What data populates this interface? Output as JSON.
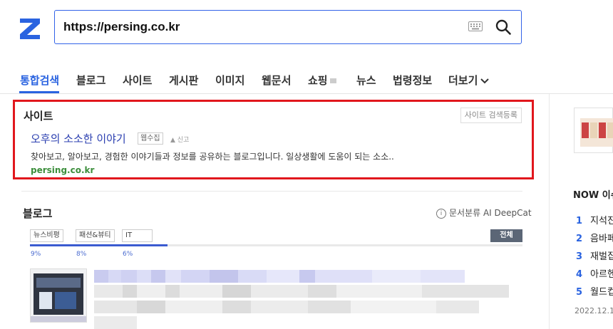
{
  "search": {
    "query": "https://persing.co.kr"
  },
  "tabs": [
    {
      "label": "통합검색",
      "active": true
    },
    {
      "label": "블로그"
    },
    {
      "label": "사이트"
    },
    {
      "label": "게시판"
    },
    {
      "label": "이미지"
    },
    {
      "label": "웹문서"
    },
    {
      "label": "쇼핑"
    },
    {
      "label": "뉴스"
    },
    {
      "label": "법령정보"
    },
    {
      "label": "더보기"
    }
  ],
  "site_section": {
    "title": "사이트",
    "register_label": "사이트 검색등록",
    "result": {
      "title": "오후의 소소한 이야기",
      "badge": "웹수집",
      "report": "신고",
      "description": "찾아보고, 알아보고, 경험한 이야기들과 정보를 공유하는 블로그입니다. 일상생활에 도움이 되는 소소..",
      "url": "persing.co.kr"
    }
  },
  "blog_section": {
    "title": "블로그",
    "deepcat_label": "문서분류 AI DeepCat",
    "categories": [
      {
        "label": "뉴스비평",
        "percent": "9%"
      },
      {
        "label": "패션&뷰티",
        "percent": "8%"
      },
      {
        "label": "IT",
        "percent": "6%"
      }
    ],
    "all_label": "전체",
    "progress": 0.28
  },
  "right_panel": {
    "now_title": "NOW 이슈",
    "ranks": [
      {
        "num": "1",
        "text": "지석진"
      },
      {
        "num": "2",
        "text": "음바페"
      },
      {
        "num": "3",
        "text": "재벌집"
      },
      {
        "num": "4",
        "text": "아르헨"
      },
      {
        "num": "5",
        "text": "월드컵"
      }
    ],
    "date": "2022.12.1"
  },
  "colors": {
    "brand_blue": "#2a63e0",
    "highlight_red": "#e1171d",
    "url_green": "#3b8e3b"
  },
  "icons": [
    "zum-logo",
    "keyboard-icon",
    "search-icon",
    "chevron-down-icon",
    "info-icon"
  ]
}
